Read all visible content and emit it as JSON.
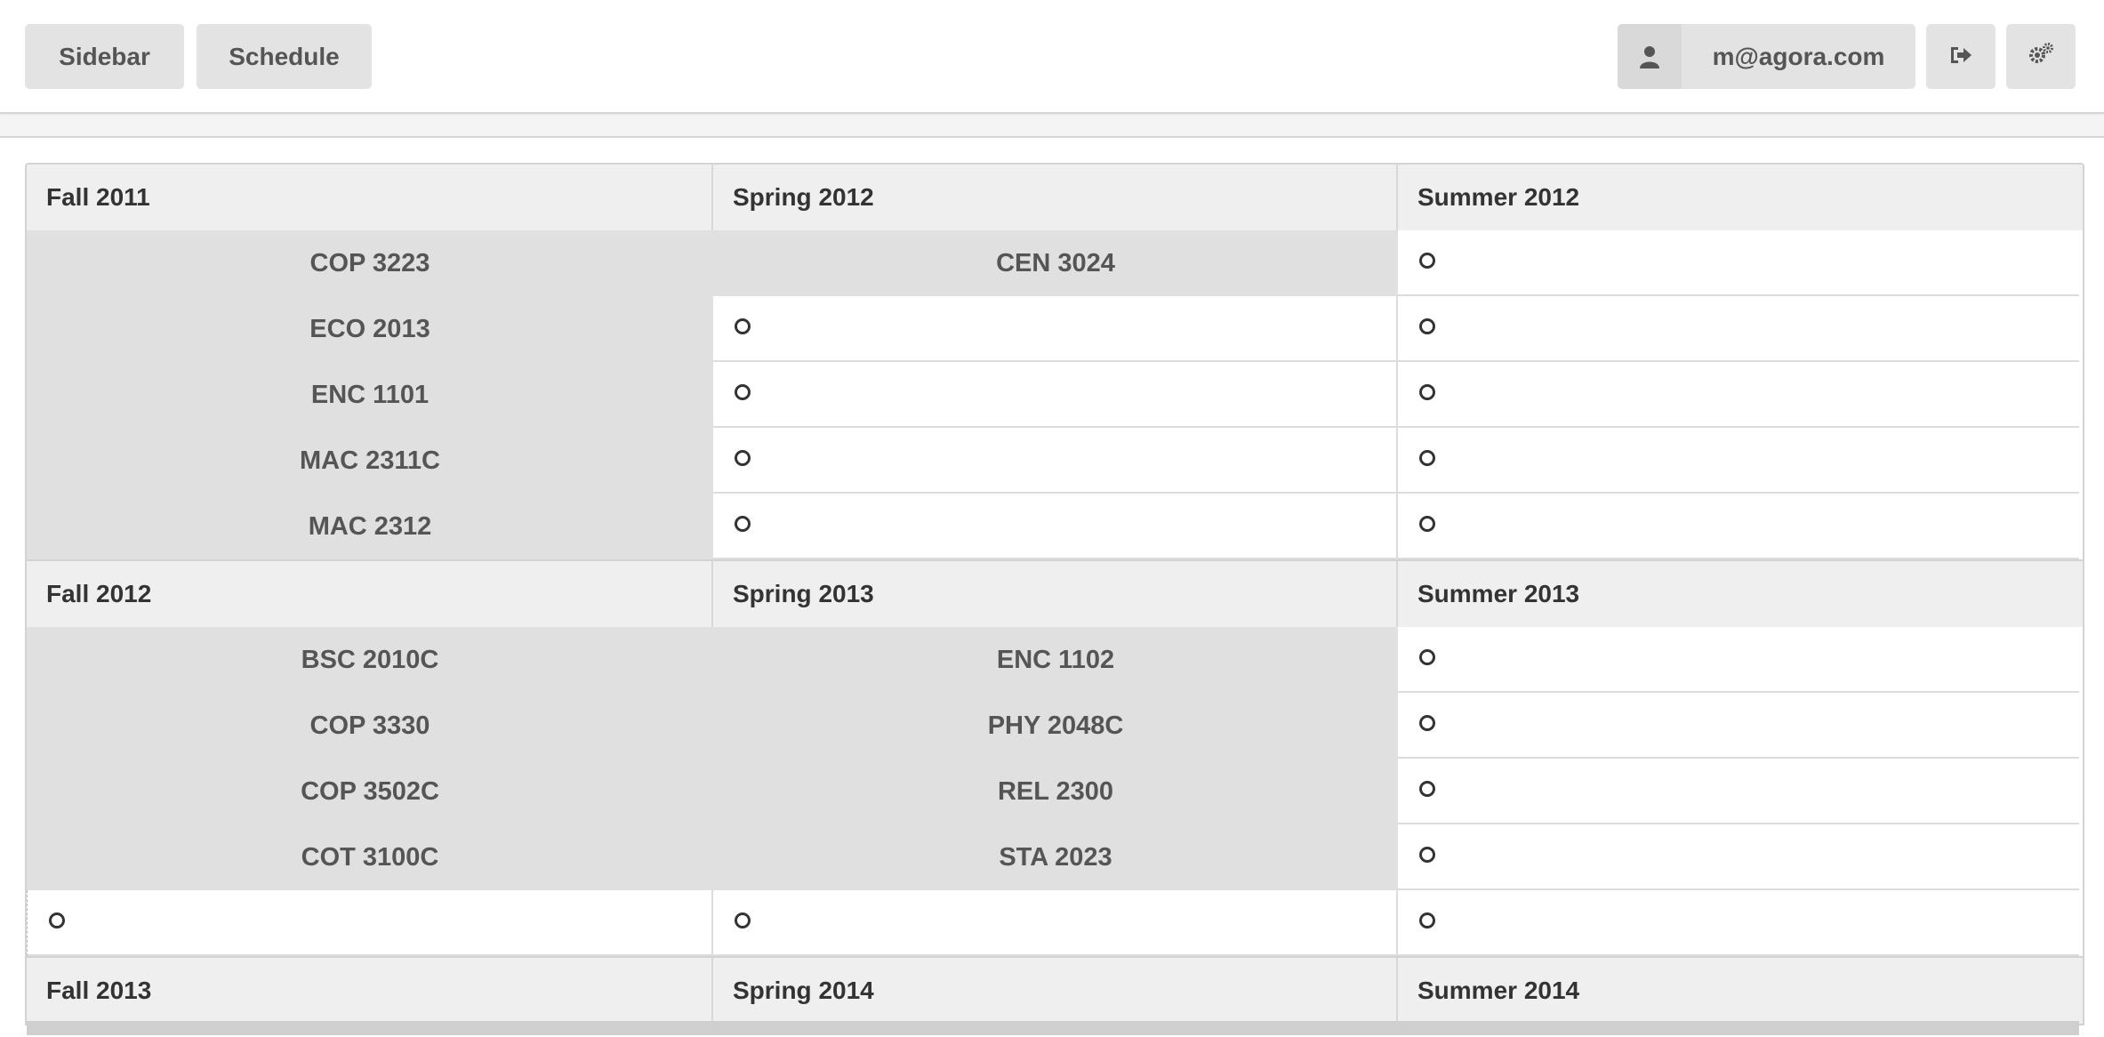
{
  "toolbar": {
    "sidebar_label": "Sidebar",
    "schedule_label": "Schedule",
    "user_email": "m@agora.com",
    "user_icon": "user-icon",
    "logout_icon": "sign-out-icon",
    "settings_icon": "gears-icon"
  },
  "blocks": [
    {
      "terms": [
        "Fall 2011",
        "Spring 2012",
        "Summer 2012"
      ],
      "courses": [
        [
          "COP 3223",
          "CEN 3024",
          ""
        ],
        [
          "ECO 2013",
          "",
          ""
        ],
        [
          "ENC 1101",
          "",
          ""
        ],
        [
          "MAC 2311C",
          "",
          ""
        ],
        [
          "MAC 2312",
          "",
          ""
        ]
      ]
    },
    {
      "terms": [
        "Fall 2012",
        "Spring 2013",
        "Summer 2013"
      ],
      "courses": [
        [
          "BSC 2010C",
          "ENC 1102",
          ""
        ],
        [
          "COP 3330",
          "PHY 2048C",
          ""
        ],
        [
          "COP 3502C",
          "REL 2300",
          ""
        ],
        [
          "COT 3100C",
          "STA 2023",
          ""
        ],
        [
          "",
          "",
          ""
        ]
      ]
    },
    {
      "terms": [
        "Fall 2013",
        "Spring 2014",
        "Summer 2014"
      ],
      "courses": []
    }
  ]
}
